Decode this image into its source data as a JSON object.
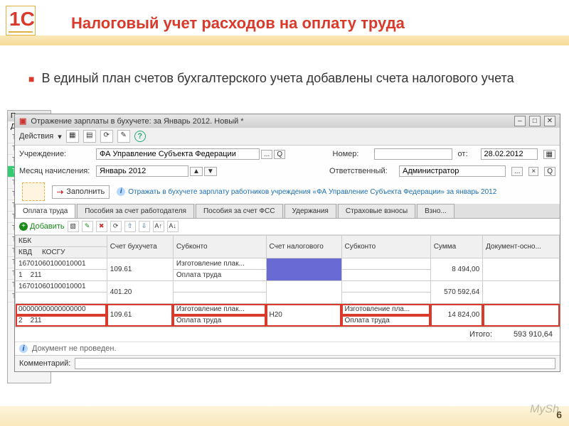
{
  "logo": {
    "glyph": "1С"
  },
  "slide": {
    "title": "Налоговый учет расходов на оплату труда",
    "bullet": "В единый план счетов бухгалтерского учета добавлены счета налогового учета"
  },
  "back_window": {
    "title_prefix": "План",
    "actions_label": "Действия",
    "t_marks": [
      "Т",
      "Т",
      "Т",
      "Т",
      "Т",
      "Т",
      "Т",
      "Т",
      "Т",
      "Т",
      "Т",
      "Т",
      "Т",
      "Т",
      "Т"
    ]
  },
  "window": {
    "title": "Отражение зарплаты в бухучете: за Январь 2012. Новый *",
    "controls": {
      "min": "–",
      "restore": "□",
      "close": "✕"
    },
    "toolbar": {
      "actions": "Действия"
    },
    "form": {
      "org_label": "Учреждение:",
      "org_value": "ФА Управление Субъекта Федерации",
      "number_label": "Номер:",
      "number_value": "",
      "from_label": "от:",
      "from_value": "28.02.2012",
      "month_label": "Месяц начисления:",
      "month_value": "Январь 2012",
      "resp_label": "Ответственный:",
      "resp_value": "Администратор"
    },
    "fill": {
      "button": "Заполнить",
      "info": "Отражать в бухучете зарплату работников учреждения «ФА Управление Субъекта Федерации» за январь 2012"
    },
    "tabs": {
      "items": [
        "Оплата труда",
        "Пособия за счет работодателя",
        "Пособия за счет ФСС",
        "Удержания",
        "Страховые взносы",
        "Взно..."
      ],
      "active_index": 0
    },
    "grid_toolbar": {
      "add": "Добавить"
    },
    "grid": {
      "headers": {
        "kbk": "КБК",
        "kvd": "КВД",
        "kosgu": "КОСГУ",
        "acct": "Счет бухучета",
        "subk": "Субконто",
        "tax_acct": "Счет налогового",
        "tax_subk": "Субконто",
        "sum": "Сумма",
        "doc": "Документ-осно..."
      },
      "rows": [
        {
          "kbk": "16701060100010001",
          "kvd": "1",
          "kosgu": "211",
          "acct": "109.61",
          "subk1": "Изготовление плак...",
          "subk2": "Оплата труда",
          "tax_acct": "",
          "tax_subk1": "",
          "tax_subk2": "",
          "sum": "8 494,00",
          "doc": "",
          "highlight_tax": true
        },
        {
          "kbk": "16701060100010001",
          "kvd": "",
          "kosgu": "",
          "acct": "401.20",
          "subk1": "",
          "subk2": "",
          "tax_acct": "",
          "tax_subk1": "",
          "tax_subk2": "",
          "sum": "570 592,64",
          "doc": ""
        },
        {
          "kbk": "00000000000000000",
          "kvd": "2",
          "kosgu": "211",
          "acct": "109.61",
          "subk1": "Изготовление плак...",
          "subk2": "Оплата труда",
          "tax_acct": "Н20",
          "tax_subk1": "Изготовление пла...",
          "tax_subk2": "Оплата труда",
          "sum": "14 824,00",
          "doc": "",
          "row_highlight": true
        }
      ],
      "totals_label": "Итого:",
      "totals_value": "593 910,64"
    },
    "status": "Документ не проведен.",
    "comment_label": "Комментарий:"
  },
  "watermark": "MySh",
  "page_number": "6"
}
